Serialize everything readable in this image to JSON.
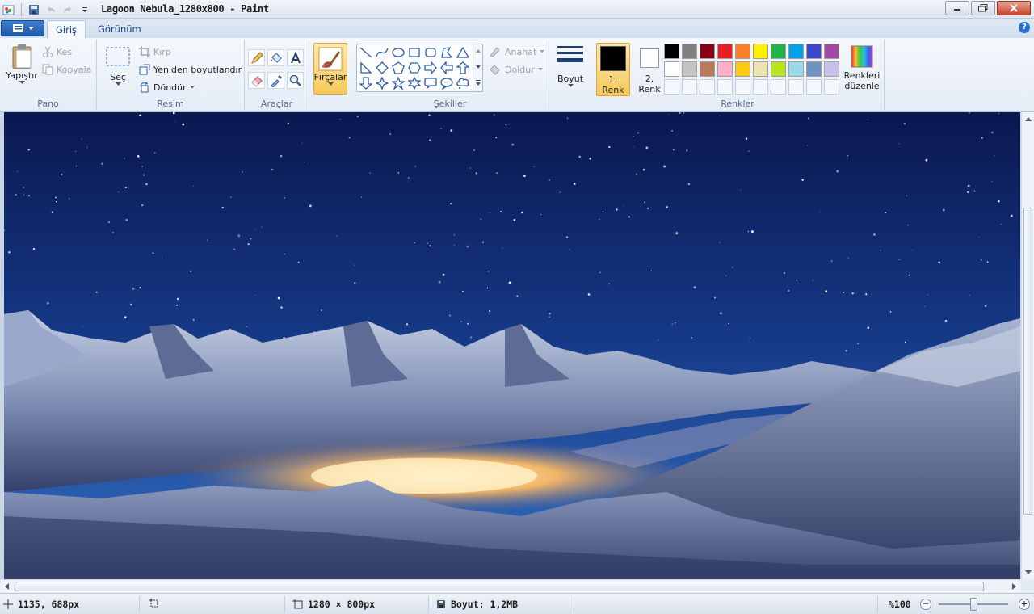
{
  "window": {
    "title": "Lagoon Nebula_1280x800 - Paint"
  },
  "tabs": [
    {
      "label": "Giriş",
      "active": true
    },
    {
      "label": "Görünüm",
      "active": false
    }
  ],
  "help_label": "?",
  "ribbon": {
    "clipboard": {
      "group_label": "Pano",
      "paste": "Yapıştır",
      "cut": "Kes",
      "copy": "Kopyala"
    },
    "image": {
      "group_label": "Resim",
      "select": "Seç",
      "crop": "Kırp",
      "resize": "Yeniden boyutlandır",
      "rotate": "Döndür"
    },
    "tools": {
      "group_label": "Araçlar"
    },
    "brushes": {
      "label": "Fırçalar"
    },
    "shapes": {
      "group_label": "Şekiller",
      "outline": "Anahat",
      "fill": "Doldur"
    },
    "size": {
      "label": "Boyut"
    },
    "colors": {
      "group_label": "Renkler",
      "color1_line1": "1.",
      "color1_line2": "Renk",
      "color2_line1": "2.",
      "color2_line2": "Renk",
      "edit_line1": "Renkleri",
      "edit_line2": "düzenle",
      "color1_value": "#000000",
      "color2_value": "#ffffff",
      "palette_row1": [
        "#000000",
        "#7f7f7f",
        "#880015",
        "#ed1c24",
        "#ff7f27",
        "#fff200",
        "#22b14c",
        "#00a2e8",
        "#3f48cc",
        "#a349a4"
      ],
      "palette_row2": [
        "#ffffff",
        "#c3c3c3",
        "#b97a57",
        "#ffaec9",
        "#ffc90e",
        "#efe4b0",
        "#b5e61d",
        "#99d9ea",
        "#7092be",
        "#c8bfe7"
      ]
    }
  },
  "status": {
    "cursor_pos": "1135, 688px",
    "image_size": "1280 × 800px",
    "file_size": "Boyut: 1,2MB",
    "zoom": "%100",
    "zoom_fraction": 0.5
  }
}
